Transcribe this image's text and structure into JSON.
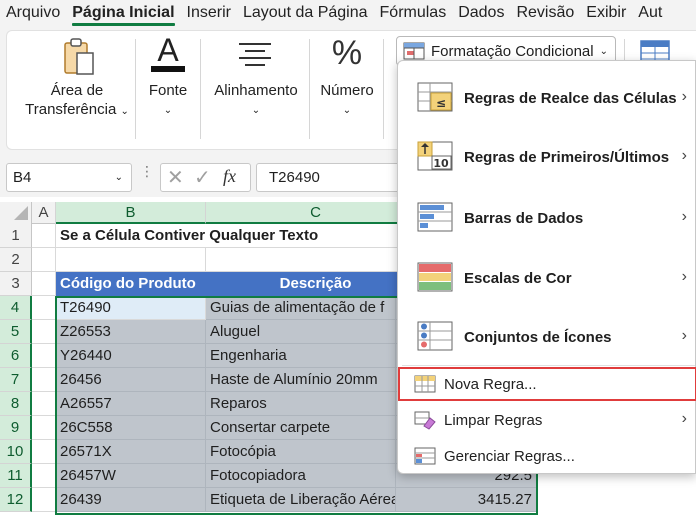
{
  "menubar": {
    "tabs": [
      "Arquivo",
      "Página Inicial",
      "Inserir",
      "Layout da Página",
      "Fórmulas",
      "Dados",
      "Revisão",
      "Exibir",
      "Aut"
    ],
    "active_index": 1
  },
  "ribbon": {
    "clipboard_label_1": "Área de",
    "clipboard_label_2": "Transferência",
    "font_label": "Fonte",
    "alignment_label": "Alinhamento",
    "number_label": "Número",
    "percent_glyph": "%",
    "font_glyph": "A",
    "conditional_formatting_label": "Formatação Condicional"
  },
  "formula_bar": {
    "name_box": "B4",
    "fx": "fx",
    "formula": "T26490"
  },
  "sheet": {
    "columns": [
      "A",
      "B",
      "C"
    ],
    "rows": [
      "1",
      "2",
      "3",
      "4",
      "5",
      "6",
      "7",
      "8",
      "9",
      "10",
      "11",
      "12"
    ],
    "title": "Se a Célula Contiver Qualquer Texto",
    "header_product_code": "Código do Produto",
    "header_description": "Descrição",
    "data": [
      {
        "code": "T26490",
        "desc": "Guias de alimentação de f",
        "value": ""
      },
      {
        "code": "Z26553",
        "desc": "Aluguel",
        "value": ""
      },
      {
        "code": "Y26440",
        "desc": "Engenharia",
        "value": ""
      },
      {
        "code": "26456",
        "desc": "Haste de Alumínio 20mm",
        "value": ""
      },
      {
        "code": "A26557",
        "desc": "Reparos",
        "value": ""
      },
      {
        "code": "26C558",
        "desc": "Consertar carpete",
        "value": ""
      },
      {
        "code": "26571X",
        "desc": "Fotocópia",
        "value": ""
      },
      {
        "code": "26457W",
        "desc": "Fotocopiadora",
        "value": "292.5"
      },
      {
        "code": "26439",
        "desc": "Etiqueta de Liberação Aérea",
        "value": "3415.27"
      }
    ]
  },
  "conditional_menu": {
    "items": [
      {
        "label": "Regras de Realce das Células",
        "icon": "highlight-rules-icon"
      },
      {
        "label": "Regras de Primeiros/Últimos",
        "icon": "top-bottom-rules-icon"
      },
      {
        "label": "Barras de Dados",
        "icon": "data-bars-icon"
      },
      {
        "label": "Escalas de Cor",
        "icon": "color-scales-icon"
      },
      {
        "label": "Conjuntos de Ícones",
        "icon": "icon-sets-icon"
      }
    ],
    "new_rule": "Nova Regra...",
    "clear_rules": "Limpar Regras",
    "manage_rules": "Gerenciar Regras...",
    "top_bottom_icon_number": "10",
    "highlight_icon_symbol": "≤"
  }
}
